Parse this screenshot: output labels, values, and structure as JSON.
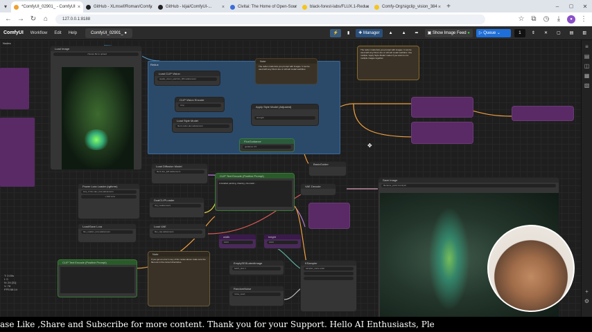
{
  "browser": {
    "tabs": [
      {
        "label": "*ComfyUI_02901_ - ComfyUI",
        "color": "#f0a030",
        "active": true
      },
      {
        "label": "GitHub - XLmsef/Roman/Comfy",
        "color": "#222",
        "active": false
      },
      {
        "label": "GitHub - kijai/ComfyUI-...",
        "color": "#222",
        "active": false
      },
      {
        "label": "Civitai: The Home of Open-Sour",
        "color": "#3a6ed8",
        "active": false
      },
      {
        "label": "black-forest-labs/FLUX.1-Redux",
        "color": "#f5c518",
        "active": false
      },
      {
        "label": "Comfy-Org/sigclip_vision_384",
        "color": "#f5c518",
        "active": false
      }
    ],
    "address": "127.0.0.1:8188"
  },
  "app": {
    "logo": "ComfyUI",
    "menus": [
      "Workflow",
      "Edit",
      "Help"
    ],
    "workflow_tab": "ComfyUI_02901_",
    "manager_label": "Manager",
    "image_feed_label": "Show Image Feed",
    "queue_label": "Queue",
    "queue_count": "1",
    "colors": {
      "accent": "#1e6fd9",
      "node_bg": "#353535",
      "green_group": "#2a5a3a",
      "purple_group": "#5a2a66",
      "blue_group": "#2b4a6a"
    }
  },
  "canvas": {
    "label_top_left": "Nodes",
    "nodes": {
      "load_image": {
        "title": "Load Image",
        "widget": "choose file to upload"
      },
      "note_top": {
        "title": "Note",
        "text": "The redux model lets you prompt with images. It can be used with any Flux1 dev or schnell model workflow."
      },
      "note_right": {
        "title": "",
        "text": "The redux model lets you prompt with images. It can be used with any Flux1 dev or schnell model workflow. Use multiple 'Apply Style Model' nodes if you want to mix multiple images together."
      },
      "load_clip_vision": {
        "title": "Load CLIP Vision",
        "widget": "sigclip_vision_patch14_384.safetensors"
      },
      "clip_vision_encode": {
        "title": "CLIP Vision Encode",
        "widget": "crop"
      },
      "load_style_model": {
        "title": "Load Style Model",
        "widget": "flux1-redux-dev.safetensors"
      },
      "apply_style_model": {
        "title": "Apply Style Model (Adjusted)",
        "widget": "strength"
      },
      "flux_guidance": {
        "title": "FluxGuidance",
        "widget": "guidance 3.5"
      },
      "load_diffusion_model": {
        "title": "Load Diffusion Model",
        "widget": "flux1-dev_fp8.safetensors"
      },
      "clip_text_encode_pos": {
        "title": "CLIP Text Encode (Positive Prompt)",
        "text": "A detailed painting, drawing, cinematic..."
      },
      "power_lora_loader": {
        "title": "Power Lora Loader (rgthree)",
        "widget": "lora_1 Flux-dev_lora.safetensors"
      },
      "dual_clip_loader": {
        "title": "DualCLIPLoader",
        "widget": "clip_l.safetensors"
      },
      "load_vae": {
        "title": "Load VAE",
        "widget": "flux_vae.safetensors"
      },
      "load_lora": {
        "title": "Load/Save Lora",
        "widget": "flux_realism_lora.safetensors"
      },
      "clip_text_encode_neg": {
        "title": "CLIP Text Encode (Positive Prompt)",
        "text": ""
      },
      "note_bottom": {
        "title": "Note",
        "text": "If you get an error in any of the nodes above make sure the files are in the correct directories."
      },
      "width": {
        "title": "width",
        "widget": "1024"
      },
      "height": {
        "title": "height",
        "widget": "1024"
      },
      "empty_latent": {
        "title": "EmptySD3LatentImage",
        "widget": "batch_size 1"
      },
      "random_noise": {
        "title": "RandomNoise",
        "widget": "noise_seed"
      },
      "ksampler": {
        "title": "KSampler",
        "widget": "sampler_name euler"
      },
      "basic_guider": {
        "title": "BasicGuider",
        "widget": ""
      },
      "vae_decode": {
        "title": "VAE Decode",
        "widget": ""
      },
      "save_image": {
        "title": "Save Image",
        "widget": "filename_prefix ComfyUI"
      }
    },
    "stats": [
      "T: 0.00s",
      "I: 0",
      "N: 24 [31]",
      "V: 78",
      "FPS:58.14"
    ]
  },
  "subtitle": "ase Like ,Share and Subscribe for more content. Thank you for your Support.      Hello AI Enthusiasts, Ple"
}
